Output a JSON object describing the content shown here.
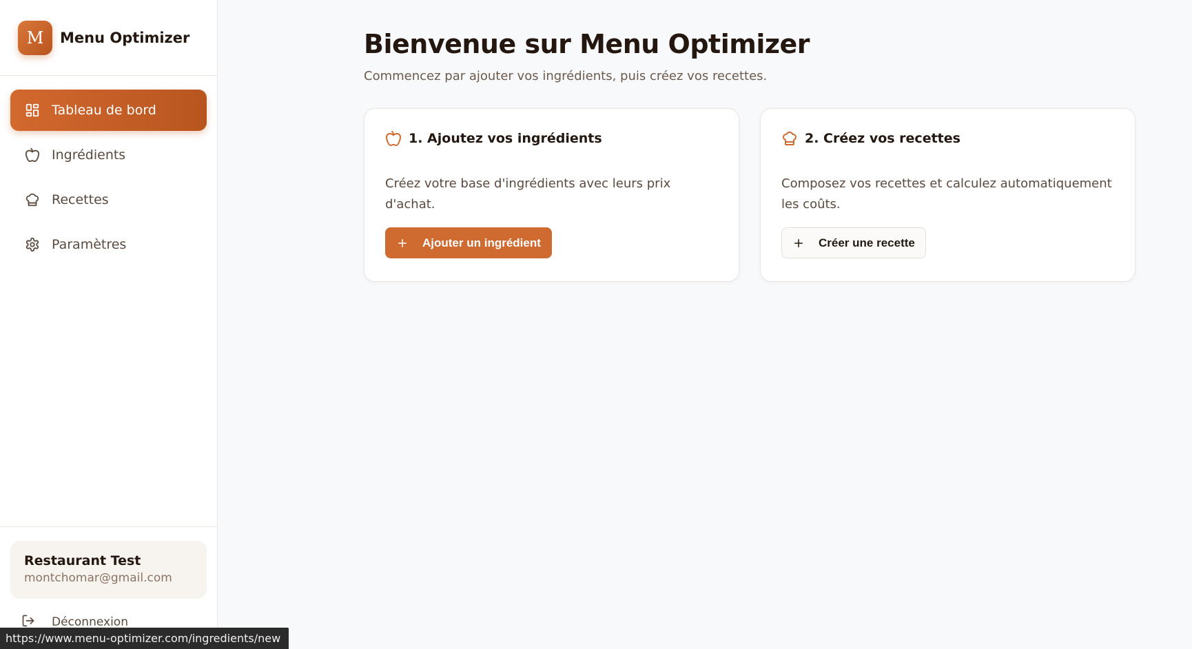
{
  "brand": {
    "logo_letter": "M",
    "name": "Menu Optimizer"
  },
  "nav": {
    "items": [
      {
        "label": "Tableau de bord",
        "icon": "dashboard-icon",
        "active": true
      },
      {
        "label": "Ingrédients",
        "icon": "apple-icon",
        "active": false
      },
      {
        "label": "Recettes",
        "icon": "chef-hat-icon",
        "active": false
      },
      {
        "label": "Paramètres",
        "icon": "gear-icon",
        "active": false
      }
    ]
  },
  "user": {
    "name": "Restaurant Test",
    "email": "montchomar@gmail.com"
  },
  "logout": {
    "label": "Déconnexion",
    "icon": "logout-icon"
  },
  "main": {
    "title": "Bienvenue sur Menu Optimizer",
    "subtitle": "Commencez par ajouter vos ingrédients, puis créez vos recettes.",
    "cards": [
      {
        "title": "1. Ajoutez vos ingrédients",
        "icon": "apple-icon",
        "description": "Créez votre base d'ingrédients avec leurs prix d'achat.",
        "button_label": "Ajouter un ingrédient",
        "button_icon": "plus-icon"
      },
      {
        "title": "2. Créez vos recettes",
        "icon": "chef-hat-icon",
        "description": "Composez vos recettes et calculez automatiquement les coûts.",
        "button_label": "Créer une recette",
        "button_icon": "plus-icon"
      }
    ]
  },
  "status_bar": {
    "url": "https://www.menu-optimizer.com/ingredients/new"
  },
  "colors": {
    "accent": "#cf6a30",
    "background": "#f8f9fb"
  }
}
